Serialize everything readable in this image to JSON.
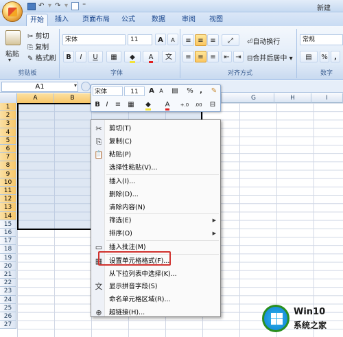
{
  "window": {
    "title": "新建 ",
    "brand": "#1f5fa8"
  },
  "quick_access": {
    "save_icon": "save-icon",
    "undo_icon": "undo-icon",
    "redo_icon": "redo-icon",
    "preview_icon": "print-preview-icon"
  },
  "tabs": [
    "开始",
    "插入",
    "页面布局",
    "公式",
    "数据",
    "审阅",
    "视图"
  ],
  "ribbon": {
    "clipboard": {
      "paste": "粘贴",
      "cut": "剪切",
      "copy": "复制",
      "format_painter": "格式刷",
      "group": "剪贴板"
    },
    "font": {
      "name": "宋体",
      "size": "11",
      "grow": "A",
      "shrink": "A",
      "bold": "B",
      "italic": "I",
      "underline": "U",
      "font_color_letter": "A",
      "font_color": "#e02020",
      "fill_color": "#f3e23a",
      "group": "字体"
    },
    "alignment": {
      "wrap": "自动换行",
      "merge": "合并后居中",
      "group": "对齐方式"
    },
    "number": {
      "format": "常规",
      "percent": "%",
      "comma": ",",
      "group": "数字"
    }
  },
  "formula": {
    "namebox": "A1",
    "fx": "fx"
  },
  "columns": [
    "A",
    "B",
    "C",
    "D",
    "E",
    "F",
    "G",
    "H",
    "I"
  ],
  "rows": [
    "1",
    "2",
    "3",
    "4",
    "5",
    "6",
    "7",
    "8",
    "9",
    "10",
    "11",
    "12",
    "13",
    "14",
    "15",
    "16",
    "17",
    "18",
    "19",
    "20",
    "21",
    "22",
    "23",
    "24",
    "25",
    "26",
    "27"
  ],
  "mini_toolbar": {
    "font": "宋体",
    "size": "11",
    "grow": "A",
    "shrink": "A",
    "percent": "%",
    "comma": ",",
    "bold": "B",
    "italic": "I",
    "inc_dec": "+.0",
    "dec_dec": ".00"
  },
  "context_menu": {
    "items": [
      {
        "label": "剪切(T)",
        "icon": "scissors-icon"
      },
      {
        "label": "复制(C)",
        "icon": "copy-icon"
      },
      {
        "label": "粘贴(P)",
        "icon": "paste-icon"
      },
      {
        "label": "选择性粘贴(V)...",
        "icon": ""
      },
      {
        "label": "插入(I)...",
        "icon": ""
      },
      {
        "label": "删除(D)...",
        "icon": ""
      },
      {
        "label": "清除内容(N)",
        "icon": ""
      },
      {
        "label": "筛选(E)",
        "icon": ""
      },
      {
        "label": "排序(O)",
        "icon": ""
      },
      {
        "label": "插入批注(M)",
        "icon": "comment-icon"
      },
      {
        "label": "设置单元格格式(F)...",
        "icon": "format-cells-icon"
      },
      {
        "label": "从下拉列表中选择(K)...",
        "icon": ""
      },
      {
        "label": "显示拼音字段(S)",
        "icon": "phonetic-icon"
      },
      {
        "label": "命名单元格区域(R)...",
        "icon": ""
      },
      {
        "label": "超链接(H)...",
        "icon": "hyperlink-icon"
      }
    ],
    "highlighted_index": 10,
    "highlight_color": "#d0312d"
  },
  "watermark": {
    "line1": "Win10",
    "line2": "系统之家"
  }
}
